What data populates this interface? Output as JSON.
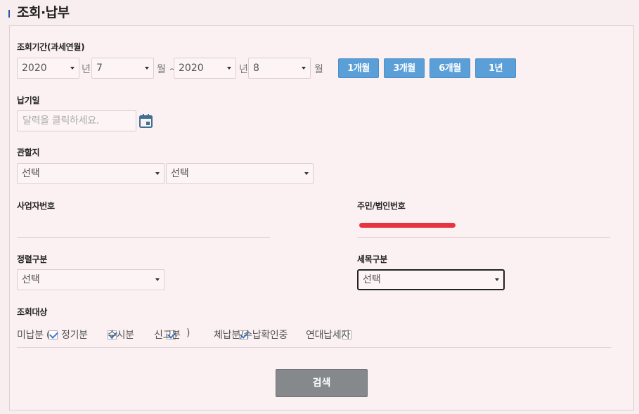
{
  "page": {
    "title": "조회·납부"
  },
  "period": {
    "label": "조회기간(과세연월)",
    "from_year": "2020",
    "year_unit": "년",
    "from_month": "7",
    "month_unit_tilde": "월 ~",
    "to_year": "2020",
    "to_month": "8",
    "month_unit": "월",
    "buttons": [
      "1개월",
      "3개월",
      "6개월",
      "1년"
    ]
  },
  "due_date": {
    "label": "납기일",
    "placeholder": "달력을 클릭하세요.",
    "icon": "calendar-icon"
  },
  "jurisdiction": {
    "label": "관할지",
    "select1": "선택",
    "select2": "선택"
  },
  "business_no": {
    "label": "사업자번호",
    "value": ""
  },
  "resident_no": {
    "label": "주민/법인번호",
    "value_redacted": true
  },
  "regular_type": {
    "label": "정렬구분",
    "value": "선택"
  },
  "tax_type": {
    "label": "세목구분",
    "value": "선택"
  },
  "target": {
    "label": "조회대상",
    "unpaid_prefix": "미납분 (",
    "options": [
      {
        "label": "정기분",
        "checked": true
      },
      {
        "label": "수시분",
        "checked": true
      },
      {
        "label": "신고분",
        "checked": true
      }
    ],
    "close_paren": ")",
    "delinquent": {
      "label": "체납분/수납확인중",
      "checked": true
    },
    "joint": {
      "label": "연대납세자",
      "checked": false
    }
  },
  "search_button": "검색",
  "colors": {
    "accent": "#5b9fd8",
    "background": "#f9eeef",
    "button_gray": "#85898c"
  }
}
